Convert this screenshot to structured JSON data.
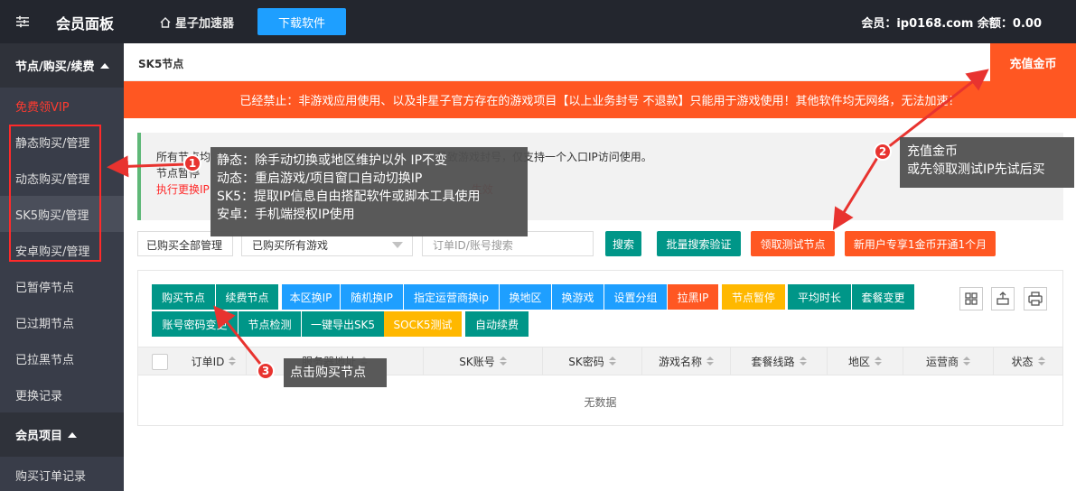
{
  "topbar": {
    "brand": "会员面板",
    "home_link": "星子加速器",
    "download_label": "下载软件",
    "account": "会员：ip0168.com 余额：0.00"
  },
  "sidebar": {
    "group1": "节点/购买/续费",
    "items": [
      "免费领VIP",
      "静态购买/管理",
      "动态购买/管理",
      "SK5购买/管理",
      "安卓购买/管理",
      "已暂停节点",
      "已过期节点",
      "已拉黑节点",
      "更换记录"
    ],
    "group2": "会员项目",
    "items2": [
      "购买订单记录"
    ]
  },
  "content": {
    "title": "SK5节点",
    "recharge_label": "充值金币",
    "warning": "已经禁止：非游戏应用使用、以及非星子官方存在的游戏项目【以上业务封号 不退款】只能用于游戏使用！其他软件均无网络，无法加速！",
    "notice_line1": "所有节点均……                                             支持一个入口IP访问使用。",
    "notice_line1_start": "所有节点均",
    "notice_line1_end": "导致游戏封号，仅支持一个入口IP访问使用。",
    "notice_line2": "节点暂停",
    "notice_line3": "执行更换IP",
    "notice_line3_end": "生效"
  },
  "filters": {
    "select1": "已购买全部管理",
    "select2": "已购买所有游戏",
    "search_placeholder": "订单ID/账号搜索",
    "search_btn": "搜索",
    "bulk_verify": "批量搜索验证",
    "trial_node": "领取测试节点",
    "new_user": "新用户专享1金币开通1个月"
  },
  "toolbar": {
    "row1": [
      "购买节点",
      "续费节点",
      "本区换IP",
      "随机换IP",
      "指定运营商换ip",
      "换地区",
      "换游戏",
      "设置分组",
      "拉黑IP",
      "节点暂停",
      "平均时长",
      "套餐变更"
    ],
    "row2": [
      "账号密码变更",
      "节点检测",
      "一键导出SK5",
      "SOCK5测试",
      "自动续费"
    ]
  },
  "table": {
    "columns": [
      "订单ID",
      "服务器地址",
      "SK账号",
      "SK密码",
      "游戏名称",
      "套餐线路",
      "地区",
      "运营商",
      "状态"
    ],
    "empty_text": "无数据"
  },
  "annotations": {
    "tip1": [
      "静态：除手动切换或地区维护以外 IP不变",
      "动态：重启游戏/项目窗口自动切换IP",
      "SK5：提取IP信息自由搭配软件或脚本工具使用",
      "安卓：手机端授权IP使用"
    ],
    "tip2": [
      "充值金币",
      "或先领取测试IP先试后买"
    ],
    "tip3": "点击购买节点",
    "badges": [
      "1",
      "2",
      "3"
    ]
  },
  "colors": {
    "topbar": "#23262e",
    "sidebar": "#393d49",
    "accent_orange": "#ff5722",
    "teal": "#009688",
    "blue": "#1e9fff",
    "yellow": "#ffb800",
    "annotation_red": "#e8332f"
  }
}
